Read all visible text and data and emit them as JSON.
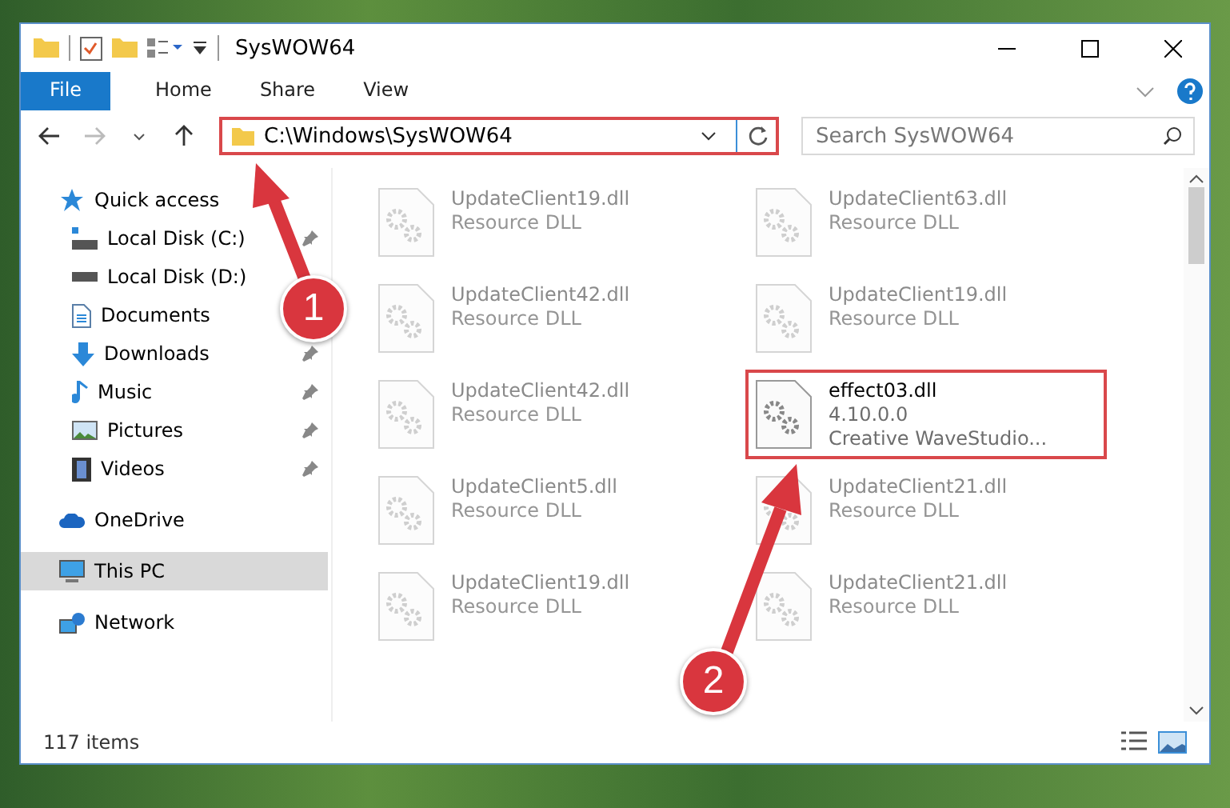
{
  "window": {
    "title": "SysWOW64"
  },
  "ribbon_tabs": [
    {
      "label": "File",
      "kind": "file",
      "selected": false
    },
    {
      "label": "Home",
      "kind": "tab",
      "selected": false
    },
    {
      "label": "Share",
      "kind": "tab",
      "selected": false
    },
    {
      "label": "View",
      "kind": "tab",
      "selected": false
    }
  ],
  "address": {
    "path": "C:\\Windows\\SysWOW64",
    "highlighted": true
  },
  "search": {
    "placeholder": "Search SysWOW64"
  },
  "navigation": [
    {
      "label": "Quick access",
      "selected": false,
      "children": [
        {
          "label": "Local Disk (C:)",
          "pinned": true,
          "selected": false
        },
        {
          "label": "Local Disk (D:)",
          "pinned": false,
          "selected": false
        },
        {
          "label": "Documents",
          "pinned": false,
          "selected": false
        },
        {
          "label": "Downloads",
          "pinned": true,
          "selected": false
        },
        {
          "label": "Music",
          "pinned": true,
          "selected": false
        },
        {
          "label": "Pictures",
          "pinned": true,
          "selected": false
        },
        {
          "label": "Videos",
          "pinned": true,
          "selected": false
        }
      ]
    },
    {
      "label": "OneDrive",
      "selected": false
    },
    {
      "label": "This PC",
      "selected": true
    },
    {
      "label": "Network",
      "selected": false
    }
  ],
  "files": [
    {
      "name": "UpdateClient19.dll",
      "details": [
        "Resource DLL"
      ],
      "faded": true,
      "highlighted": false
    },
    {
      "name": "UpdateClient63.dll",
      "details": [
        "Resource DLL"
      ],
      "faded": true,
      "highlighted": false
    },
    {
      "name": "UpdateClient42.dll",
      "details": [
        "Resource DLL"
      ],
      "faded": true,
      "highlighted": false
    },
    {
      "name": "UpdateClient19.dll",
      "details": [
        "Resource DLL"
      ],
      "faded": true,
      "highlighted": false
    },
    {
      "name": "UpdateClient42.dll",
      "details": [
        "Resource DLL"
      ],
      "faded": true,
      "highlighted": false
    },
    {
      "name": "effect03.dll",
      "details": [
        "4.10.0.0",
        "Creative WaveStudio..."
      ],
      "faded": false,
      "highlighted": true
    },
    {
      "name": "UpdateClient5.dll",
      "details": [
        "Resource DLL"
      ],
      "faded": true,
      "highlighted": false
    },
    {
      "name": "UpdateClient21.dll",
      "details": [
        "Resource DLL"
      ],
      "faded": true,
      "highlighted": false
    },
    {
      "name": "UpdateClient19.dll",
      "details": [
        "Resource DLL"
      ],
      "faded": true,
      "highlighted": false
    },
    {
      "name": "UpdateClient21.dll",
      "details": [
        "Resource DLL"
      ],
      "faded": true,
      "highlighted": false
    }
  ],
  "status_bar": {
    "item_count": "117 items"
  },
  "annotations": [
    {
      "number": "1"
    },
    {
      "number": "2"
    }
  ]
}
